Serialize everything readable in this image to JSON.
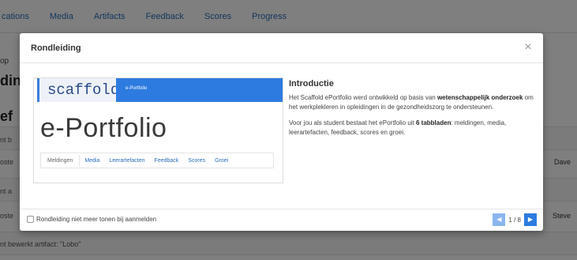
{
  "background": {
    "nav": [
      "cations",
      "Media",
      "Artifacts",
      "Feedback",
      "Scores",
      "Progress"
    ],
    "side_text_1": "op",
    "heading_1": "din",
    "heading_2": "ef",
    "row_labels": [
      "nt b",
      "oste",
      "nt a",
      "oste"
    ],
    "names": [
      "Dave",
      "Steve"
    ],
    "bottom_text": "nt bewerkt artifact: \"Lobo\""
  },
  "modal": {
    "title": "Rondleiding",
    "close_icon": "close-icon",
    "preview": {
      "logo": "scaffold",
      "brand_tab": "e-Portfolio",
      "big_title": "e-Portfolio",
      "tabs": [
        "Meldingen",
        "Media",
        "Leerartefacten",
        "Feedback",
        "Scores",
        "Groei"
      ]
    },
    "intro": {
      "heading": "Introductie",
      "p1_a": "Het Scaffold ePortfolio werd ontwikkeld op basis van ",
      "p1_b": "wetenschappelijk onderzoek",
      "p1_c": " om het werkplekleren in opleidingen in de gezondheidszorg te ondersteunen.",
      "p2_a": "Voor jou als student bestaat het ePortfolio uit ",
      "p2_b": "6 tabbladen",
      "p2_c": ": meldingen, media, leerartefacten, feedback, scores en groei."
    },
    "footer": {
      "checkbox_label": "Rondleiding niet meer tonen bij aanmelden",
      "checkbox_checked": false,
      "prev_icon": "chevron-left-icon",
      "next_icon": "chevron-right-icon",
      "page_indicator": "1 / 8"
    }
  },
  "colors": {
    "accent": "#2d7be0",
    "overlay": "rgba(0,0,0,0.5)"
  }
}
